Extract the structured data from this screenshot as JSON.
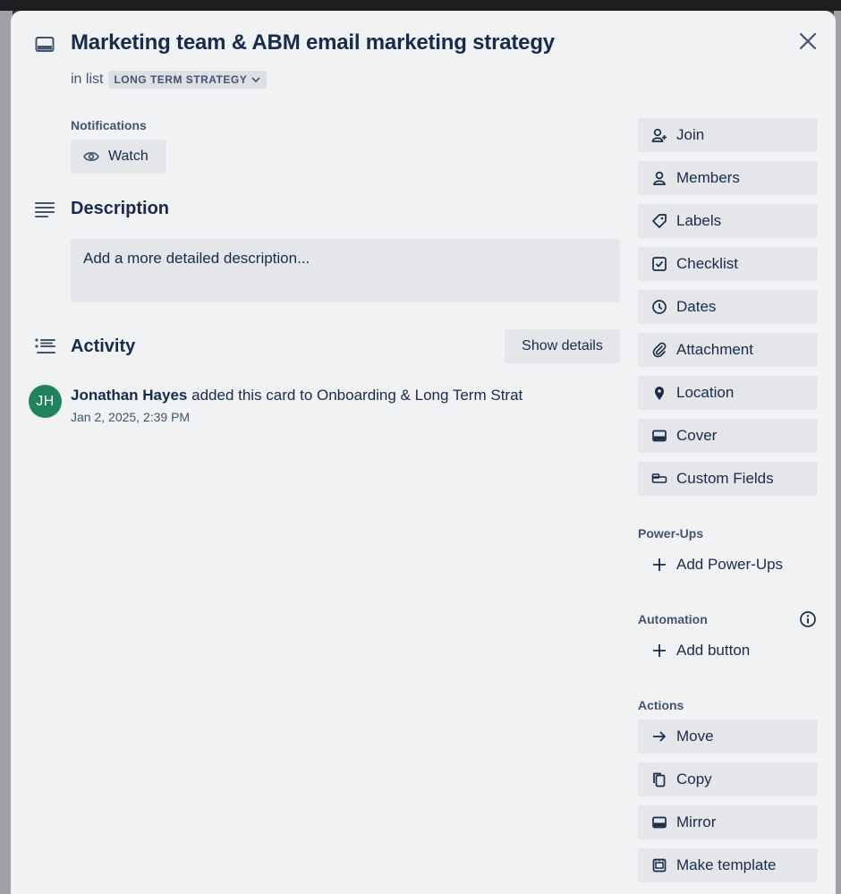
{
  "card": {
    "title": "Marketing team & ABM email marketing strategy",
    "in_list_prefix": "in list",
    "list_name": "LONG TERM STRATEGY"
  },
  "notifications": {
    "label": "Notifications",
    "watch_label": "Watch"
  },
  "description": {
    "title": "Description",
    "placeholder": "Add a more detailed description..."
  },
  "activity": {
    "title": "Activity",
    "show_details_label": "Show details",
    "items": [
      {
        "avatar_initials": "JH",
        "avatar_color": "#1f845a",
        "user": "Jonathan Hayes",
        "action": "added this card to Onboarding & Long Term Strat",
        "timestamp": "Jan 2, 2025, 2:39 PM"
      }
    ]
  },
  "sidebar": {
    "add_to_card": [
      {
        "label": "Join",
        "icon": "join-icon"
      },
      {
        "label": "Members",
        "icon": "person-icon"
      },
      {
        "label": "Labels",
        "icon": "label-icon"
      },
      {
        "label": "Checklist",
        "icon": "checklist-icon"
      },
      {
        "label": "Dates",
        "icon": "clock-icon"
      },
      {
        "label": "Attachment",
        "icon": "paperclip-icon"
      },
      {
        "label": "Location",
        "icon": "location-pin-icon"
      },
      {
        "label": "Cover",
        "icon": "cover-icon"
      },
      {
        "label": "Custom Fields",
        "icon": "custom-fields-icon"
      }
    ],
    "power_ups_label": "Power-Ups",
    "add_power_ups_label": "Add Power-Ups",
    "automation_label": "Automation",
    "add_button_label": "Add button",
    "actions_label": "Actions",
    "actions": [
      {
        "label": "Move",
        "icon": "arrow-right-icon"
      },
      {
        "label": "Copy",
        "icon": "copy-icon"
      },
      {
        "label": "Mirror",
        "icon": "mirror-icon"
      },
      {
        "label": "Make template",
        "icon": "template-icon"
      }
    ]
  },
  "colors": {
    "modal_bg": "#f1f2f4",
    "button_bg": "#e4e6ea",
    "text_primary": "#172b4d",
    "text_subtle": "#44546f"
  }
}
